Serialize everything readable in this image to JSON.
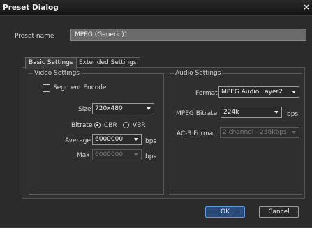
{
  "window": {
    "title": "Preset Dialog",
    "close_glyph": "×"
  },
  "preset": {
    "label": "Preset name",
    "value": "MPEG (Generic)1"
  },
  "tabs": [
    {
      "label": "Basic Settings",
      "active": true
    },
    {
      "label": "Extended Settings",
      "active": false
    }
  ],
  "video": {
    "group_title": "Video Settings",
    "segment_encode_label": "Segment Encode",
    "segment_encode_checked": false,
    "size_label": "Size",
    "size_value": "720x480",
    "bitrate_label": "Bitrate",
    "cbr_label": "CBR",
    "vbr_label": "VBR",
    "bitrate_mode": "CBR",
    "average_label": "Average",
    "average_value": "6000000",
    "average_unit": "bps",
    "max_label": "Max",
    "max_value": "6000000",
    "max_unit": "bps"
  },
  "audio": {
    "group_title": "Audio Settings",
    "format_label": "Format",
    "format_value": "MPEG Audio Layer2",
    "mpeg_bitrate_label": "MPEG Bitrate",
    "mpeg_bitrate_value": "224k",
    "mpeg_bitrate_unit": "bps",
    "ac3_label": "AC-3 Format",
    "ac3_value": "2 channel - 256kbps"
  },
  "buttons": {
    "ok": "OK",
    "cancel": "Cancel"
  },
  "colors": {
    "ok_accent": "#5b9be0"
  }
}
